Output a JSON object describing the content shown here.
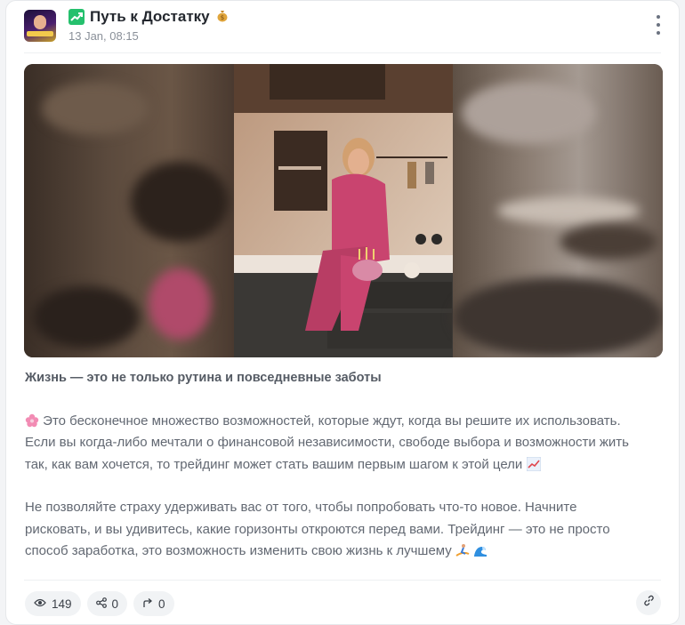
{
  "post": {
    "channel_title": "Путь к Достатку",
    "channel_title_icon": "chart-up-icon",
    "channel_suffix_icon": "money-bag-icon",
    "date": "13 Jan, 08:15",
    "menu_icon": "kebab-menu-icon"
  },
  "body": {
    "heading": "Жизнь — это не только рутина и повседневные заботы",
    "p1_icon": "cherry-blossom-icon",
    "p1_line1": "Это бесконечное множество возможностей, которые ждут, когда вы решите их использовать.",
    "p1_line2": "Если вы когда-либо мечтали о финансовой независимости, свободе выбора и возможности жить",
    "p1_line3": "так, как вам хочется, то трейдинг может стать вашим первым шагом к этой цели",
    "p1_end_icon": "chart-increasing-icon",
    "p2_line1": "Не позволяйте страху удерживать вас от того, чтобы попробовать что-то новое. Начните",
    "p2_line2": "рисковать, и вы удивитесь, какие горизонты откроются перед вами. Трейдинг — это не просто",
    "p2_line3": "способ заработка, это возможность изменить свою жизнь к лучшему",
    "p2_end_icons": [
      "surfer-icon",
      "wave-icon"
    ]
  },
  "footer": {
    "views": "149",
    "shares": "0",
    "reposts": "0",
    "views_icon": "eye-icon",
    "shares_icon": "share-icon",
    "reposts_icon": "forward-arrow-icon",
    "link_icon": "link-icon"
  },
  "colors": {
    "accent_green": "#25c06d",
    "text_muted": "#626872",
    "pill_bg": "#f1f3f5"
  }
}
